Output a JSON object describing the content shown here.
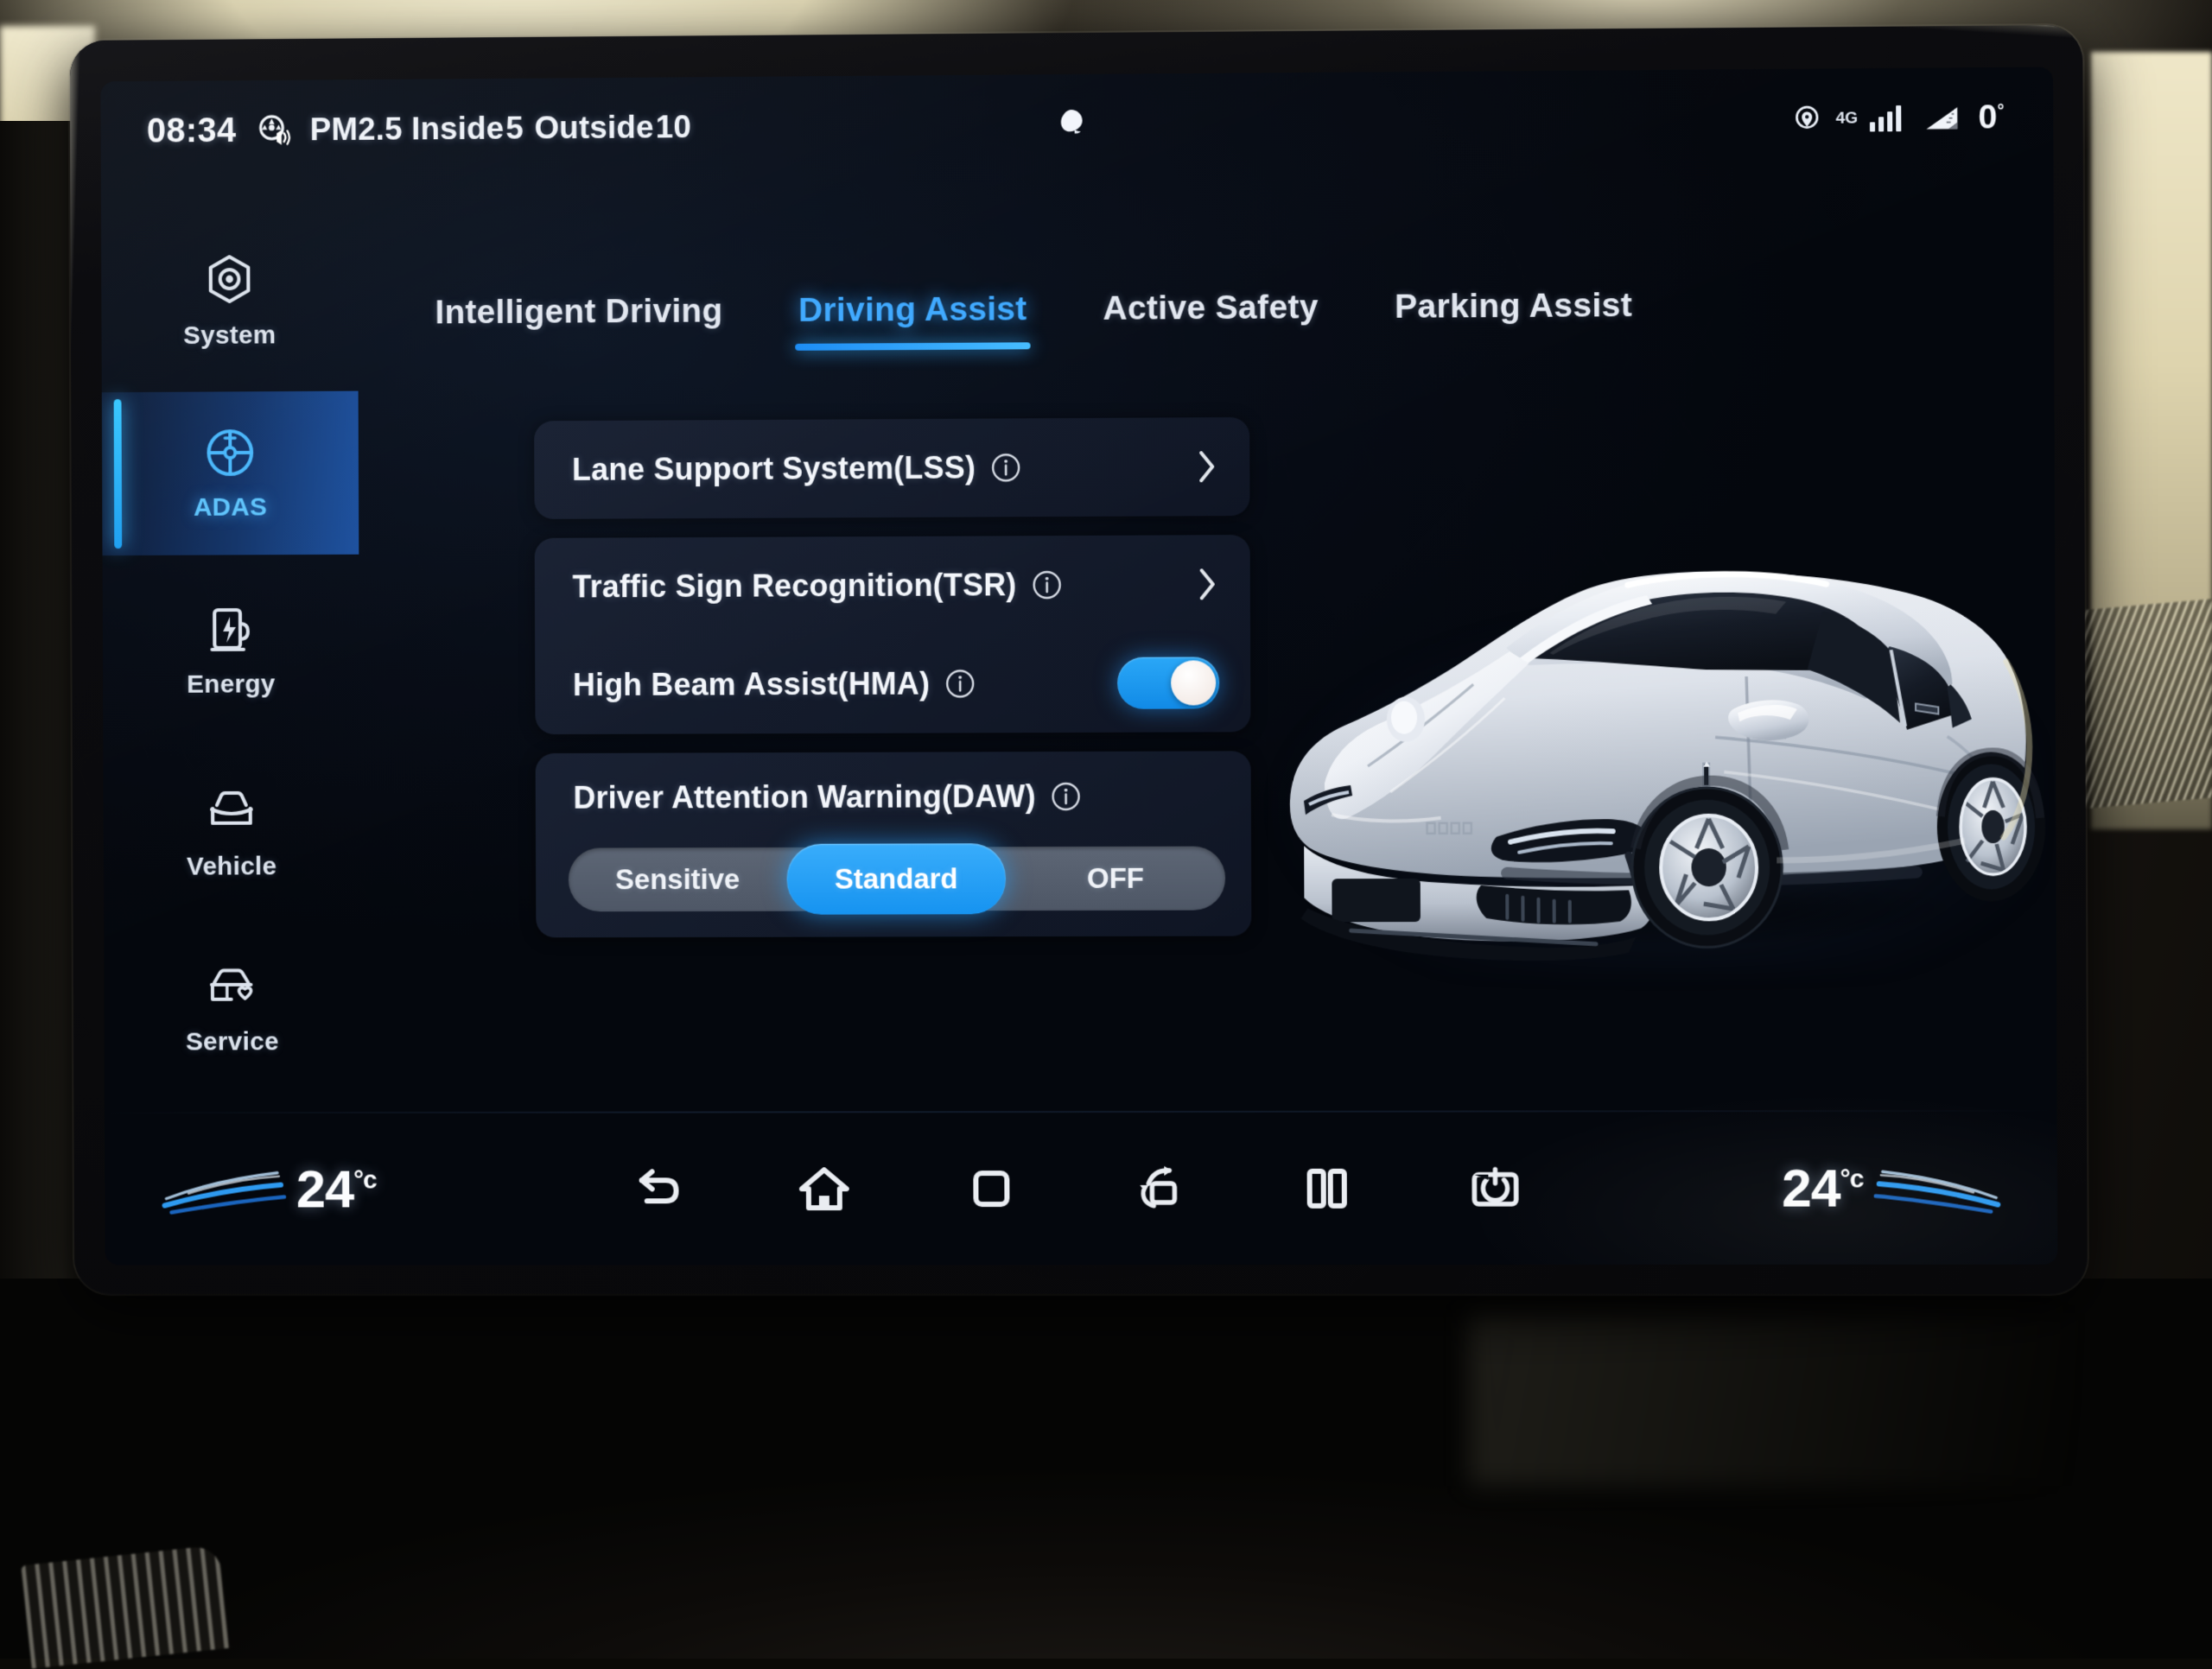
{
  "status_bar": {
    "time": "08:34",
    "air_quality_icon": "pm25-purifier-icon",
    "air_quality_prefix": "PM2.5",
    "inside_label": "Inside",
    "inside_value": "5",
    "outside_label": "Outside",
    "outside_value": "10",
    "notification_icon": "notification-dot-icon",
    "location_icon": "location-pin-icon",
    "network_label": "4G",
    "signal_icon": "signal-bars-icon",
    "slope_icon": "slope-incline-icon",
    "slope_value": "0",
    "slope_unit": "°"
  },
  "sidebar": {
    "items": [
      {
        "label": "System",
        "icon": "hexagon-gear-icon",
        "active": false
      },
      {
        "label": "ADAS",
        "icon": "steering-wheel-icon",
        "active": true
      },
      {
        "label": "Energy",
        "icon": "charging-station-icon",
        "active": false
      },
      {
        "label": "Vehicle",
        "icon": "car-front-icon",
        "active": false
      },
      {
        "label": "Service",
        "icon": "car-heart-icon",
        "active": false
      }
    ]
  },
  "tabs": [
    {
      "label": "Intelligent Driving",
      "active": false
    },
    {
      "label": "Driving Assist",
      "active": true
    },
    {
      "label": "Active Safety",
      "active": false
    },
    {
      "label": "Parking Assist",
      "active": false
    }
  ],
  "settings": {
    "cards": [
      {
        "rows": [
          {
            "title": "Lane Support System(LSS)",
            "info_icon": "info-circle-icon",
            "control": "chevron",
            "chevron_icon": "chevron-right-icon"
          }
        ]
      },
      {
        "rows": [
          {
            "title": "Traffic Sign Recognition(TSR)",
            "info_icon": "info-circle-icon",
            "control": "chevron",
            "chevron_icon": "chevron-right-icon"
          },
          {
            "title": "High Beam Assist(HMA)",
            "info_icon": "info-circle-icon",
            "control": "toggle",
            "toggle_on": true
          }
        ]
      },
      {
        "rows": [
          {
            "title": "Driver Attention Warning(DAW)",
            "info_icon": "info-circle-icon",
            "control": "segmented"
          }
        ],
        "segmented": {
          "options": [
            {
              "label": "Sensitive",
              "selected": false
            },
            {
              "label": "Standard",
              "selected": true
            },
            {
              "label": "OFF",
              "selected": false
            }
          ]
        }
      }
    ]
  },
  "vehicle_render": {
    "description": "white electric sedan three-quarter front view",
    "body_color": "#e8ecf2"
  },
  "bottom_bar": {
    "left_temp": {
      "value": "24",
      "unit": "°c",
      "icon": "airflow-swoosh-icon"
    },
    "right_temp": {
      "value": "24",
      "unit": "°c",
      "icon": "airflow-swoosh-icon"
    },
    "nav_icons": [
      "back-arrow-icon",
      "home-icon",
      "recent-apps-square-icon",
      "screen-rotate-icon",
      "split-screen-icon",
      "screen-power-off-icon"
    ]
  },
  "theme": {
    "accent_blue": "#3fa9ff",
    "toggle_blue": "#1f9cf0",
    "card_bg": "#1a2234",
    "segment_track": "#565f70",
    "screen_bg": "#060b14",
    "text_primary": "#f3f6fb"
  }
}
